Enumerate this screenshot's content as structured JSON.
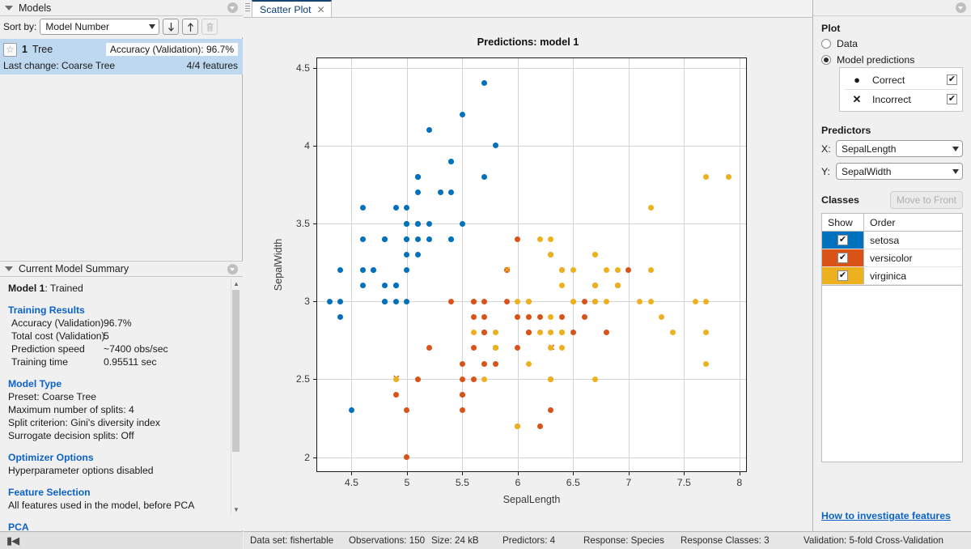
{
  "models_panel": {
    "title": "Models",
    "sort_label": "Sort by:",
    "sort_value": "Model Number",
    "sort_desc_icon": "arrow-down-icon",
    "sort_asc_icon": "arrow-up-icon",
    "delete_icon": "trash-icon",
    "card": {
      "star_icon": "star-icon",
      "number": "1",
      "type": "Tree",
      "accuracy": "Accuracy (Validation): 96.7%",
      "last_change": "Last change: Coarse Tree",
      "features": "4/4 features"
    }
  },
  "summary_panel": {
    "title": "Current Model Summary",
    "model_status_bold": "Model 1",
    "model_status_rest": ": Trained",
    "training_results_heading": "Training Results",
    "training_results": [
      {
        "key": "Accuracy (Validation)",
        "value": "96.7%"
      },
      {
        "key": "Total cost (Validation)",
        "value": "5"
      },
      {
        "key": "Prediction speed",
        "value": "~7400 obs/sec"
      },
      {
        "key": "Training time",
        "value": "0.95511 sec"
      }
    ],
    "model_type_heading": "Model Type",
    "model_type_lines": [
      "Preset: Coarse Tree",
      "Maximum number of splits: 4",
      "Split criterion: Gini's diversity index",
      "Surrogate decision splits: Off"
    ],
    "optimizer_heading": "Optimizer Options",
    "optimizer_lines": [
      "Hyperparameter options disabled"
    ],
    "feature_selection_heading": "Feature Selection",
    "feature_selection_lines": [
      "All features used in the model, before PCA"
    ],
    "pca_heading": "PCA"
  },
  "left_footer": {
    "nav_icon": "go-to-start-icon"
  },
  "center": {
    "tab_label": "Scatter Plot",
    "tab_close_icon": "close-icon",
    "gripper_icon": "drag-handle-icon"
  },
  "right_panel": {
    "close_icon": "close-icon",
    "plot_heading": "Plot",
    "radio_data": "Data",
    "radio_model_predictions": "Model predictions",
    "selected_radio": "Model predictions",
    "correct_label": "Correct",
    "incorrect_label": "Incorrect",
    "correct_glyph": "●",
    "incorrect_glyph": "✕",
    "correct_checked": "✔",
    "incorrect_checked": "✔",
    "predictors_heading": "Predictors",
    "x_label": "X:",
    "x_value": "SepalLength",
    "y_label": "Y:",
    "y_value": "SepalWidth",
    "classes_heading": "Classes",
    "move_to_front_label": "Move to Front",
    "col_show": "Show",
    "col_order": "Order",
    "classes": [
      {
        "name": "setosa",
        "color": "#0072BD",
        "checked": "✔"
      },
      {
        "name": "versicolor",
        "color": "#D95319",
        "checked": "✔"
      },
      {
        "name": "virginica",
        "color": "#EDB120",
        "checked": "✔"
      }
    ],
    "link_text": "How to investigate features"
  },
  "status_bar": {
    "items": [
      "Data set: fishertable",
      "Observations: 150",
      "Size: 24 kB",
      "Predictors: 4",
      "Response: Species",
      "Response Classes: 3",
      "Validation: 5-fold Cross-Validation"
    ]
  },
  "chart_data": {
    "type": "scatter",
    "title": "Predictions: model 1",
    "xlabel": "SepalLength",
    "ylabel": "SepalWidth",
    "xlim": [
      4.19,
      8.06
    ],
    "ylim": [
      1.91,
      4.56
    ],
    "xticks": [
      4.5,
      5,
      5.5,
      6,
      6.5,
      7,
      7.5,
      8
    ],
    "yticks": [
      2,
      2.5,
      3,
      3.5,
      4,
      4.5
    ],
    "grid": true,
    "legend": "none",
    "marker_size": 7,
    "series": [
      {
        "name": "setosa",
        "color": "#0072BD",
        "correct": [
          [
            5.1,
            3.5
          ],
          [
            4.9,
            3.0
          ],
          [
            4.7,
            3.2
          ],
          [
            4.6,
            3.1
          ],
          [
            5.0,
            3.6
          ],
          [
            5.4,
            3.9
          ],
          [
            4.6,
            3.4
          ],
          [
            5.0,
            3.4
          ],
          [
            4.4,
            2.9
          ],
          [
            4.9,
            3.1
          ],
          [
            5.4,
            3.7
          ],
          [
            4.8,
            3.4
          ],
          [
            4.8,
            3.0
          ],
          [
            4.3,
            3.0
          ],
          [
            5.8,
            4.0
          ],
          [
            5.7,
            4.4
          ],
          [
            5.4,
            3.9
          ],
          [
            5.1,
            3.5
          ],
          [
            5.7,
            3.8
          ],
          [
            5.1,
            3.8
          ],
          [
            5.4,
            3.4
          ],
          [
            5.1,
            3.7
          ],
          [
            4.6,
            3.6
          ],
          [
            5.1,
            3.3
          ],
          [
            4.8,
            3.4
          ],
          [
            5.0,
            3.0
          ],
          [
            5.0,
            3.4
          ],
          [
            5.2,
            3.5
          ],
          [
            5.2,
            3.4
          ],
          [
            4.7,
            3.2
          ],
          [
            4.8,
            3.1
          ],
          [
            5.4,
            3.4
          ],
          [
            5.2,
            4.1
          ],
          [
            5.5,
            4.2
          ],
          [
            4.9,
            3.1
          ],
          [
            5.0,
            3.2
          ],
          [
            5.5,
            3.5
          ],
          [
            4.9,
            3.6
          ],
          [
            4.4,
            3.0
          ],
          [
            5.1,
            3.4
          ],
          [
            5.0,
            3.5
          ],
          [
            4.5,
            2.3
          ],
          [
            4.4,
            3.2
          ],
          [
            5.0,
            3.5
          ],
          [
            5.1,
            3.8
          ],
          [
            4.8,
            3.0
          ],
          [
            5.1,
            3.8
          ],
          [
            4.6,
            3.2
          ],
          [
            5.3,
            3.7
          ],
          [
            5.0,
            3.3
          ]
        ],
        "incorrect": []
      },
      {
        "name": "versicolor",
        "color": "#D95319",
        "correct": [
          [
            7.0,
            3.2
          ],
          [
            6.4,
            3.2
          ],
          [
            6.9,
            3.1
          ],
          [
            5.5,
            2.3
          ],
          [
            6.5,
            2.8
          ],
          [
            5.7,
            2.8
          ],
          [
            6.3,
            3.3
          ],
          [
            4.9,
            2.4
          ],
          [
            6.6,
            2.9
          ],
          [
            5.2,
            2.7
          ],
          [
            5.0,
            2.0
          ],
          [
            5.9,
            3.0
          ],
          [
            6.0,
            2.2
          ],
          [
            6.1,
            2.9
          ],
          [
            5.6,
            2.9
          ],
          [
            6.7,
            3.1
          ],
          [
            5.6,
            3.0
          ],
          [
            5.8,
            2.7
          ],
          [
            6.2,
            2.2
          ],
          [
            5.6,
            2.5
          ],
          [
            5.9,
            3.2
          ],
          [
            6.1,
            2.8
          ],
          [
            6.3,
            2.5
          ],
          [
            6.1,
            2.8
          ],
          [
            6.4,
            2.9
          ],
          [
            6.6,
            3.0
          ],
          [
            6.8,
            2.8
          ],
          [
            6.7,
            3.0
          ],
          [
            6.0,
            2.9
          ],
          [
            5.7,
            2.6
          ],
          [
            5.5,
            2.4
          ],
          [
            5.5,
            2.4
          ],
          [
            5.8,
            2.7
          ],
          [
            6.0,
            2.7
          ],
          [
            5.4,
            3.0
          ],
          [
            6.0,
            3.4
          ],
          [
            6.7,
            3.1
          ],
          [
            6.3,
            2.3
          ],
          [
            5.6,
            3.0
          ],
          [
            5.5,
            2.5
          ],
          [
            5.5,
            2.6
          ],
          [
            6.1,
            3.0
          ],
          [
            5.8,
            2.6
          ],
          [
            5.0,
            2.3
          ],
          [
            5.6,
            2.7
          ],
          [
            5.7,
            3.0
          ],
          [
            5.7,
            2.9
          ],
          [
            6.2,
            2.9
          ],
          [
            5.1,
            2.5
          ],
          [
            5.7,
            2.8
          ]
        ],
        "incorrect": [
          [
            4.9,
            2.5
          ],
          [
            6.3,
            2.7
          ]
        ]
      },
      {
        "name": "virginica",
        "color": "#EDB120",
        "correct": [
          [
            6.3,
            3.3
          ],
          [
            5.8,
            2.7
          ],
          [
            7.1,
            3.0
          ],
          [
            6.3,
            2.9
          ],
          [
            6.5,
            3.0
          ],
          [
            7.6,
            3.0
          ],
          [
            4.9,
            2.5
          ],
          [
            7.3,
            2.9
          ],
          [
            6.7,
            2.5
          ],
          [
            7.2,
            3.6
          ],
          [
            6.5,
            3.2
          ],
          [
            6.4,
            2.7
          ],
          [
            6.8,
            3.0
          ],
          [
            5.7,
            2.5
          ],
          [
            5.8,
            2.8
          ],
          [
            6.4,
            3.2
          ],
          [
            6.5,
            3.0
          ],
          [
            7.7,
            3.8
          ],
          [
            7.7,
            2.6
          ],
          [
            6.0,
            2.2
          ],
          [
            6.9,
            3.2
          ],
          [
            5.6,
            2.8
          ],
          [
            7.7,
            2.8
          ],
          [
            6.3,
            2.7
          ],
          [
            6.7,
            3.3
          ],
          [
            7.2,
            3.2
          ],
          [
            6.2,
            2.8
          ],
          [
            6.1,
            3.0
          ],
          [
            6.4,
            2.8
          ],
          [
            7.2,
            3.0
          ],
          [
            7.4,
            2.8
          ],
          [
            7.9,
            3.8
          ],
          [
            6.4,
            2.8
          ],
          [
            6.3,
            2.8
          ],
          [
            6.1,
            2.6
          ],
          [
            7.7,
            3.0
          ],
          [
            6.3,
            3.4
          ],
          [
            6.4,
            3.1
          ],
          [
            6.0,
            3.0
          ],
          [
            6.9,
            3.1
          ],
          [
            6.7,
            3.1
          ],
          [
            6.9,
            3.1
          ],
          [
            5.8,
            2.7
          ],
          [
            6.8,
            3.2
          ],
          [
            6.7,
            3.3
          ],
          [
            6.7,
            3.0
          ],
          [
            6.3,
            2.5
          ],
          [
            6.5,
            3.0
          ],
          [
            6.2,
            3.4
          ]
        ],
        "incorrect": [
          [
            5.9,
            3.2
          ]
        ]
      }
    ]
  }
}
